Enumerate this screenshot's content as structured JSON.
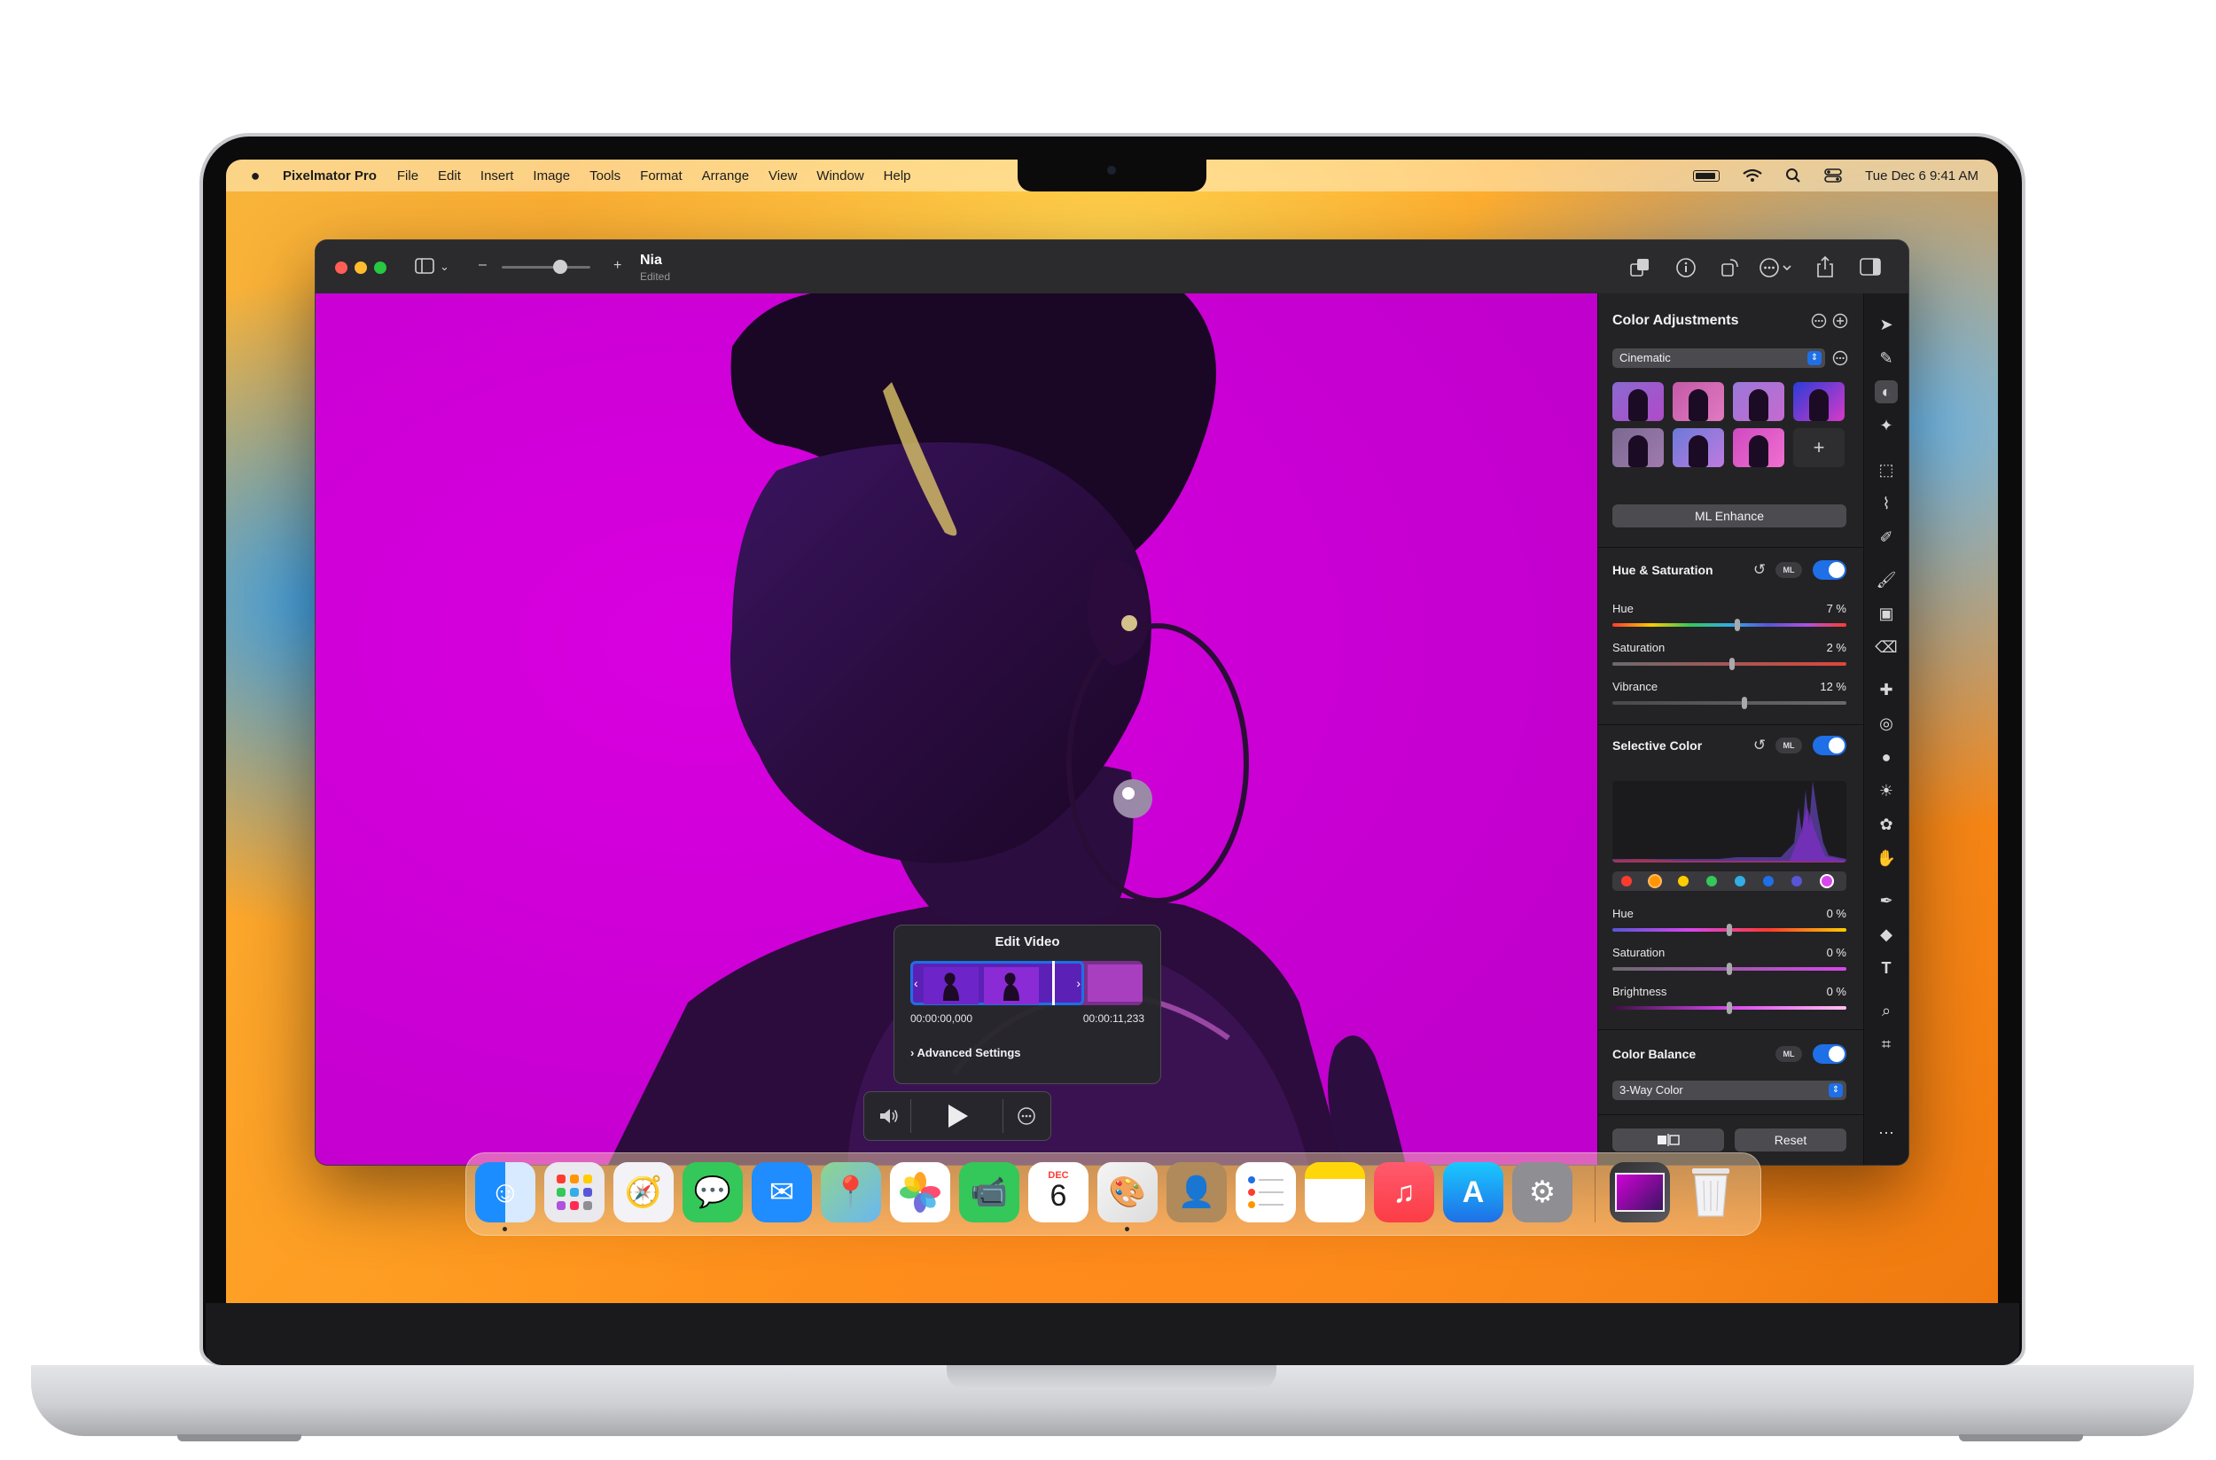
{
  "menubar": {
    "app_name": "Pixelmator Pro",
    "menus": [
      "File",
      "Edit",
      "Insert",
      "Image",
      "Tools",
      "Format",
      "Arrange",
      "View",
      "Window",
      "Help"
    ],
    "clock": "Tue Dec 6  9:41 AM"
  },
  "window": {
    "doc_title": "Nia",
    "doc_status": "Edited"
  },
  "sidebar": {
    "title": "Color Adjustments",
    "preset_dropdown": "Cinematic",
    "add_preset": "+",
    "ml_enhance": "ML Enhance",
    "hue_saturation": {
      "title": "Hue & Saturation",
      "ml": "ML",
      "sliders": [
        {
          "label": "Hue",
          "value": "7 %"
        },
        {
          "label": "Saturation",
          "value": "2 %"
        },
        {
          "label": "Vibrance",
          "value": "12 %"
        }
      ]
    },
    "selective_color": {
      "title": "Selective Color",
      "ml": "ML",
      "sliders": [
        {
          "label": "Hue",
          "value": "0 %"
        },
        {
          "label": "Saturation",
          "value": "0 %"
        },
        {
          "label": "Brightness",
          "value": "0 %"
        }
      ]
    },
    "color_balance": {
      "title": "Color Balance",
      "ml": "ML",
      "mode": "3-Way Color"
    },
    "reset": "Reset"
  },
  "edit_video": {
    "title": "Edit Video",
    "start_time": "00:00:00,000",
    "end_time": "00:00:11,233",
    "advanced": "Advanced Settings"
  },
  "dock": {
    "calendar_month": "DEC",
    "calendar_day": "6"
  },
  "colors": {
    "canvas_bg": "#d100d8",
    "accent": "#1f6fe6"
  }
}
